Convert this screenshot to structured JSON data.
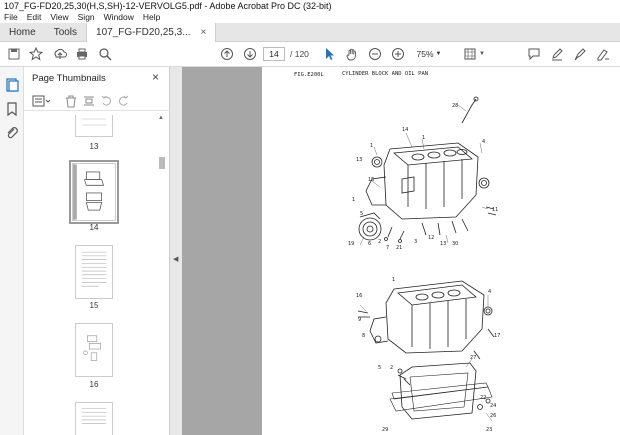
{
  "window": {
    "title": "107_FG-FD20,25,30(H,S,SH)-12-VERVOLG5.pdf - Adobe Acrobat Pro DC (32-bit)"
  },
  "menu": [
    "File",
    "Edit",
    "View",
    "Sign",
    "Window",
    "Help"
  ],
  "tabs": {
    "home": "Home",
    "tools": "Tools",
    "document": "107_FG-FD20,25,3...",
    "close": "×"
  },
  "toolbar": {
    "page_current": "14",
    "page_total": "/ 120",
    "zoom": "75%"
  },
  "thumbnails_panel": {
    "title": "Page Thumbnails",
    "close": "×",
    "pages": [
      {
        "label": "13"
      },
      {
        "label": "14"
      },
      {
        "label": "15"
      },
      {
        "label": "16"
      }
    ]
  },
  "document": {
    "fig_label": "FIG.E200L",
    "fig_title": "CYLINDER BLOCK AND OIL PAN",
    "callouts": [
      "28",
      "1",
      "4",
      "14",
      "1",
      "13",
      "15",
      "11",
      "1",
      "5",
      "19",
      "6",
      "2",
      "7",
      "21",
      "3",
      "12",
      "13",
      "30",
      "16",
      "4",
      "1",
      "9",
      "8",
      "5",
      "2",
      "27",
      "17",
      "22",
      "24",
      "26",
      "29",
      "23"
    ]
  },
  "colors": {
    "accent": "#1a73c7",
    "viewer_bg": "#a6a6a6",
    "tab_bg": "#e6e6e6"
  },
  "icons": {
    "save": "save-icon",
    "bookmark": "star-icon",
    "upload": "upload-icon",
    "print": "print-icon",
    "search": "search-icon"
  }
}
